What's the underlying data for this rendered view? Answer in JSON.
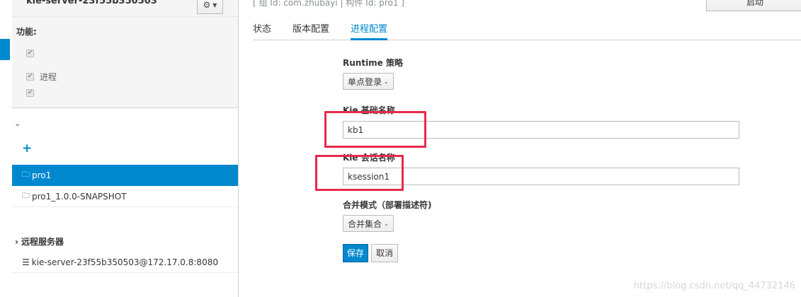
{
  "sidebar": {
    "server_name": "kie-server-23f55b350503",
    "features_title": "功能:",
    "features": [
      {
        "label": "",
        "checked": true
      },
      {
        "label": "进程",
        "checked": true
      },
      {
        "label": "",
        "checked": true
      }
    ],
    "containers": [
      {
        "label": "pro1",
        "active": true
      },
      {
        "label": "pro1_1.0.0-SNAPSHOT",
        "active": false
      }
    ],
    "remote_title": "远程服务器",
    "remote_servers": [
      "kie-server-23f55b350503@172.17.0.8:8080"
    ]
  },
  "main": {
    "group_info": "[ 组 Id: com.zhubayi | 构件 Id: pro1 ]",
    "start_label": "启动",
    "tabs": [
      {
        "label": "状态",
        "active": false
      },
      {
        "label": "版本配置",
        "active": false
      },
      {
        "label": "进程配置",
        "active": true
      }
    ],
    "runtime_label": "Runtime 策略",
    "runtime_value": "单点登录",
    "kbase_label": "Kie 基础名称",
    "kbase_value": "kb1",
    "ksession_label": "Kie 会话名称",
    "ksession_value": "ksession1",
    "merge_label": "合并模式（部署描述符)",
    "merge_value": "合并集合",
    "save_label": "保存",
    "cancel_label": "取消"
  },
  "watermark": "https://blog.csdn.net/qq_44732146",
  "colors": {
    "accent": "#0088ce",
    "highlight": "#e8294c"
  }
}
